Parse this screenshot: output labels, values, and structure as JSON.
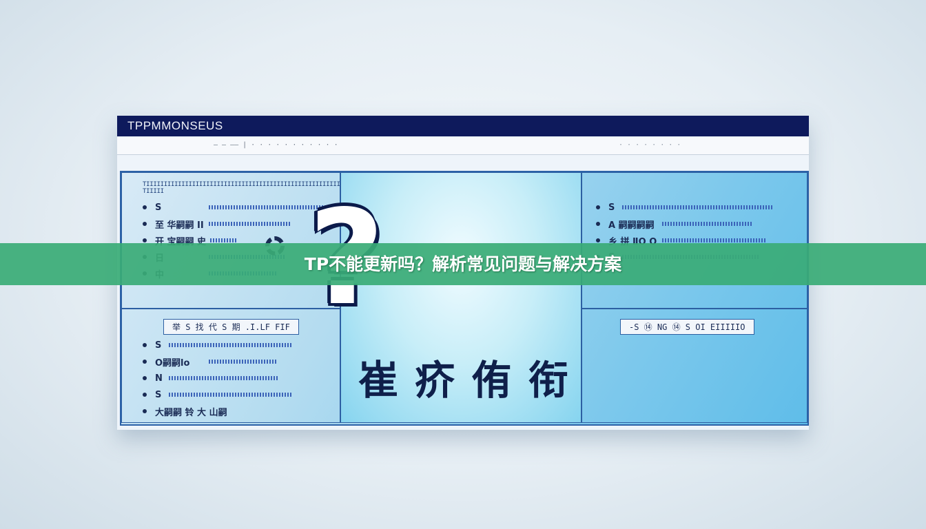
{
  "window": {
    "title": "TPPMMONSEUS",
    "toolbar_left": "— — ——  |  ·  ·  ·  ·  ·  ·  ·  ·  ·  ·  ·",
    "toolbar_right": "· ·      · ·      · · · ·"
  },
  "panel_top_left": {
    "header": "TIIIIIIIIIIIIIIIIIIIIIIIIIIIIIIIIIIIIIIIIIIIIIIIIIIIIIIIII  TIIIII",
    "items": [
      {
        "label": "S"
      },
      {
        "label": "至 华嗣嗣 II"
      },
      {
        "label": "开 宝嗣嗣 史"
      },
      {
        "label": "日"
      },
      {
        "label": "中"
      }
    ]
  },
  "panel_bottom_left": {
    "box_label": "举  S  找 代 S  期 .I.LF  FIF",
    "items": [
      {
        "label": "S"
      },
      {
        "label": "O嗣嗣lo"
      },
      {
        "label": "N"
      },
      {
        "label": "S"
      },
      {
        "label": "大嗣嗣 铃 大 山嗣"
      }
    ]
  },
  "center_panel": {
    "symbol": "?",
    "caption": "崔 疥 侑 衔"
  },
  "panel_top_right": {
    "items": [
      {
        "label": "S"
      },
      {
        "label": "A 嗣嗣嗣嗣"
      },
      {
        "label": "乡 拼 ⅡO O"
      },
      {
        "label": "S"
      }
    ]
  },
  "panel_bottom_right": {
    "box_label": "-S  ⑭  NG  ⑭  S  OI EIIIIIO"
  },
  "banner": {
    "text": "TP不能更新吗？解析常见问题与解决方案"
  },
  "colors": {
    "titlebar": "#0e1a5c",
    "banner": "#3aab76",
    "panel_gradient_end": "#5fbde9"
  }
}
